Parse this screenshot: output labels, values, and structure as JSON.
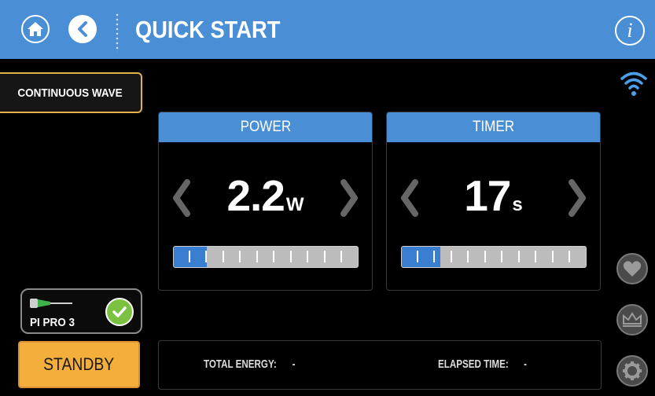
{
  "header": {
    "title": "QUICK START",
    "home_icon": "home-icon",
    "back_icon": "chevron-left-icon",
    "info_label": "i"
  },
  "mode": {
    "label": "CONTINUOUS WAVE"
  },
  "status": {
    "wifi_icon": "wifi-icon"
  },
  "power": {
    "header": "POWER",
    "value": "2.2",
    "unit": "W",
    "level_fraction": 0.18
  },
  "timer": {
    "header": "TIMER",
    "value": "17",
    "unit": "s",
    "level_fraction": 0.21
  },
  "handpiece": {
    "label": "PI PRO 3",
    "status_icon": "check-icon"
  },
  "standby": {
    "label": "STANDBY"
  },
  "info": {
    "total_energy_label": "TOTAL ENERGY:",
    "total_energy_value": "-",
    "elapsed_time_label": "ELAPSED TIME:",
    "elapsed_time_value": "-"
  },
  "side_icons": [
    "heart-icon",
    "crown-icon",
    "gear-icon"
  ],
  "colors": {
    "header_blue": "#4a8fd6",
    "bar_fill": "#3a7ed2",
    "standby_orange": "#f4ae3c",
    "mode_border": "#e5b24a",
    "check_green": "#7bc142"
  }
}
